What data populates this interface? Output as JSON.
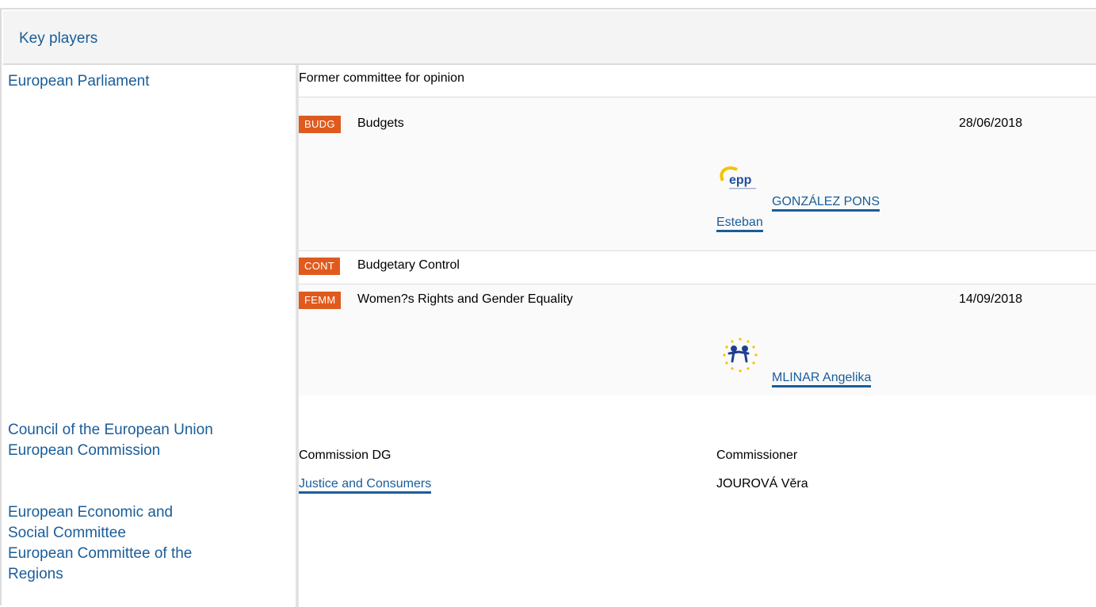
{
  "header": {
    "title": "Key players"
  },
  "institutions": {
    "parliament": "European Parliament",
    "council": "Council of the European Union",
    "commission": "European Commission",
    "eesc_line1": "European Economic and",
    "eesc_line2": "Social Committee",
    "cor_line1": "European Committee of the",
    "cor_line2": "Regions"
  },
  "parliament": {
    "former_label": "Former committee for opinion",
    "committees": [
      {
        "code": "BUDG",
        "name": "Budgets",
        "date": "28/06/2018",
        "rapporteur_line1": "GONZÁLEZ PONS",
        "rapporteur_line2": "Esteban",
        "group_logo": "epp-logo"
      },
      {
        "code": "CONT",
        "name": "Budgetary Control"
      },
      {
        "code": "FEMM",
        "name": "Women?s Rights and Gender Equality",
        "date": "14/09/2018",
        "rapporteur_line1": "MLINAR Angelika",
        "group_logo": "alde-logo"
      }
    ]
  },
  "commission": {
    "dg_label": "Commission DG",
    "commissioner_label": "Commissioner",
    "dg_value": "Justice and Consumers",
    "commissioner_value": "JOUROVÁ Věra"
  },
  "colors": {
    "link": "#1a5d99",
    "badge": "#e05a1e",
    "header_bg": "#f4f4f4"
  }
}
